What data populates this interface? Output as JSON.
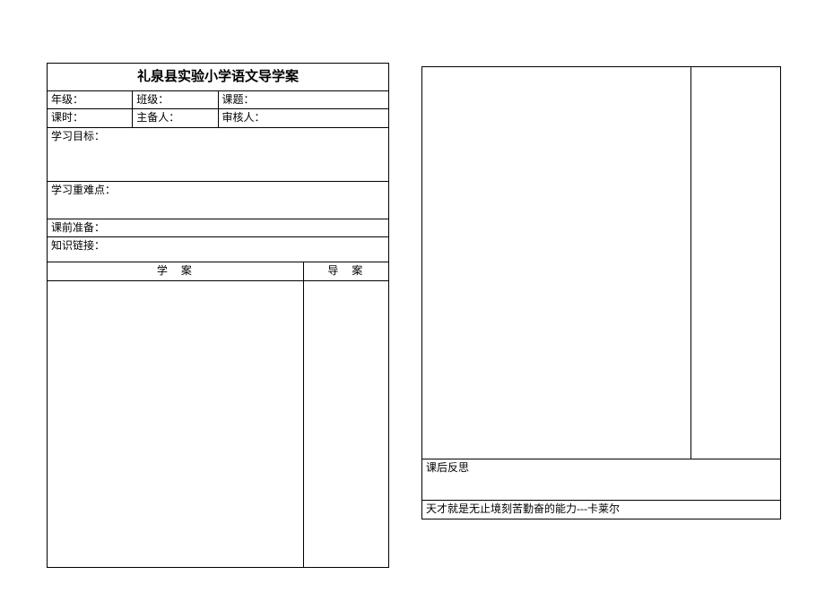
{
  "title": "礼泉县实验小学语文导学案",
  "row1": {
    "grade": "年级：",
    "class": "班级：",
    "topic": "课题："
  },
  "row2": {
    "period": "课时：",
    "preparer": "主备人：",
    "reviewer": "审核人："
  },
  "goals": "学习目标：",
  "difficulty": "学习重难点：",
  "preclass": "课前准备：",
  "link": "知识链接：",
  "col_study": "学    案",
  "col_guide": "导   案",
  "reflect": "课后反思",
  "quote": "天才就是无止境刻苦勤奋的能力---卡莱尔"
}
